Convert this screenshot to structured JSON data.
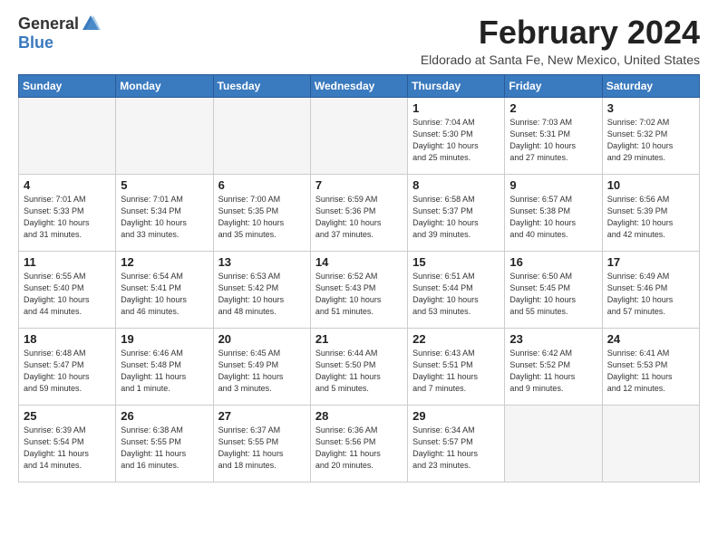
{
  "logo": {
    "general": "General",
    "blue": "Blue"
  },
  "title": "February 2024",
  "location": "Eldorado at Santa Fe, New Mexico, United States",
  "days_of_week": [
    "Sunday",
    "Monday",
    "Tuesday",
    "Wednesday",
    "Thursday",
    "Friday",
    "Saturday"
  ],
  "weeks": [
    [
      {
        "day": "",
        "info": ""
      },
      {
        "day": "",
        "info": ""
      },
      {
        "day": "",
        "info": ""
      },
      {
        "day": "",
        "info": ""
      },
      {
        "day": "1",
        "info": "Sunrise: 7:04 AM\nSunset: 5:30 PM\nDaylight: 10 hours\nand 25 minutes."
      },
      {
        "day": "2",
        "info": "Sunrise: 7:03 AM\nSunset: 5:31 PM\nDaylight: 10 hours\nand 27 minutes."
      },
      {
        "day": "3",
        "info": "Sunrise: 7:02 AM\nSunset: 5:32 PM\nDaylight: 10 hours\nand 29 minutes."
      }
    ],
    [
      {
        "day": "4",
        "info": "Sunrise: 7:01 AM\nSunset: 5:33 PM\nDaylight: 10 hours\nand 31 minutes."
      },
      {
        "day": "5",
        "info": "Sunrise: 7:01 AM\nSunset: 5:34 PM\nDaylight: 10 hours\nand 33 minutes."
      },
      {
        "day": "6",
        "info": "Sunrise: 7:00 AM\nSunset: 5:35 PM\nDaylight: 10 hours\nand 35 minutes."
      },
      {
        "day": "7",
        "info": "Sunrise: 6:59 AM\nSunset: 5:36 PM\nDaylight: 10 hours\nand 37 minutes."
      },
      {
        "day": "8",
        "info": "Sunrise: 6:58 AM\nSunset: 5:37 PM\nDaylight: 10 hours\nand 39 minutes."
      },
      {
        "day": "9",
        "info": "Sunrise: 6:57 AM\nSunset: 5:38 PM\nDaylight: 10 hours\nand 40 minutes."
      },
      {
        "day": "10",
        "info": "Sunrise: 6:56 AM\nSunset: 5:39 PM\nDaylight: 10 hours\nand 42 minutes."
      }
    ],
    [
      {
        "day": "11",
        "info": "Sunrise: 6:55 AM\nSunset: 5:40 PM\nDaylight: 10 hours\nand 44 minutes."
      },
      {
        "day": "12",
        "info": "Sunrise: 6:54 AM\nSunset: 5:41 PM\nDaylight: 10 hours\nand 46 minutes."
      },
      {
        "day": "13",
        "info": "Sunrise: 6:53 AM\nSunset: 5:42 PM\nDaylight: 10 hours\nand 48 minutes."
      },
      {
        "day": "14",
        "info": "Sunrise: 6:52 AM\nSunset: 5:43 PM\nDaylight: 10 hours\nand 51 minutes."
      },
      {
        "day": "15",
        "info": "Sunrise: 6:51 AM\nSunset: 5:44 PM\nDaylight: 10 hours\nand 53 minutes."
      },
      {
        "day": "16",
        "info": "Sunrise: 6:50 AM\nSunset: 5:45 PM\nDaylight: 10 hours\nand 55 minutes."
      },
      {
        "day": "17",
        "info": "Sunrise: 6:49 AM\nSunset: 5:46 PM\nDaylight: 10 hours\nand 57 minutes."
      }
    ],
    [
      {
        "day": "18",
        "info": "Sunrise: 6:48 AM\nSunset: 5:47 PM\nDaylight: 10 hours\nand 59 minutes."
      },
      {
        "day": "19",
        "info": "Sunrise: 6:46 AM\nSunset: 5:48 PM\nDaylight: 11 hours\nand 1 minute."
      },
      {
        "day": "20",
        "info": "Sunrise: 6:45 AM\nSunset: 5:49 PM\nDaylight: 11 hours\nand 3 minutes."
      },
      {
        "day": "21",
        "info": "Sunrise: 6:44 AM\nSunset: 5:50 PM\nDaylight: 11 hours\nand 5 minutes."
      },
      {
        "day": "22",
        "info": "Sunrise: 6:43 AM\nSunset: 5:51 PM\nDaylight: 11 hours\nand 7 minutes."
      },
      {
        "day": "23",
        "info": "Sunrise: 6:42 AM\nSunset: 5:52 PM\nDaylight: 11 hours\nand 9 minutes."
      },
      {
        "day": "24",
        "info": "Sunrise: 6:41 AM\nSunset: 5:53 PM\nDaylight: 11 hours\nand 12 minutes."
      }
    ],
    [
      {
        "day": "25",
        "info": "Sunrise: 6:39 AM\nSunset: 5:54 PM\nDaylight: 11 hours\nand 14 minutes."
      },
      {
        "day": "26",
        "info": "Sunrise: 6:38 AM\nSunset: 5:55 PM\nDaylight: 11 hours\nand 16 minutes."
      },
      {
        "day": "27",
        "info": "Sunrise: 6:37 AM\nSunset: 5:55 PM\nDaylight: 11 hours\nand 18 minutes."
      },
      {
        "day": "28",
        "info": "Sunrise: 6:36 AM\nSunset: 5:56 PM\nDaylight: 11 hours\nand 20 minutes."
      },
      {
        "day": "29",
        "info": "Sunrise: 6:34 AM\nSunset: 5:57 PM\nDaylight: 11 hours\nand 23 minutes."
      },
      {
        "day": "",
        "info": ""
      },
      {
        "day": "",
        "info": ""
      }
    ]
  ]
}
